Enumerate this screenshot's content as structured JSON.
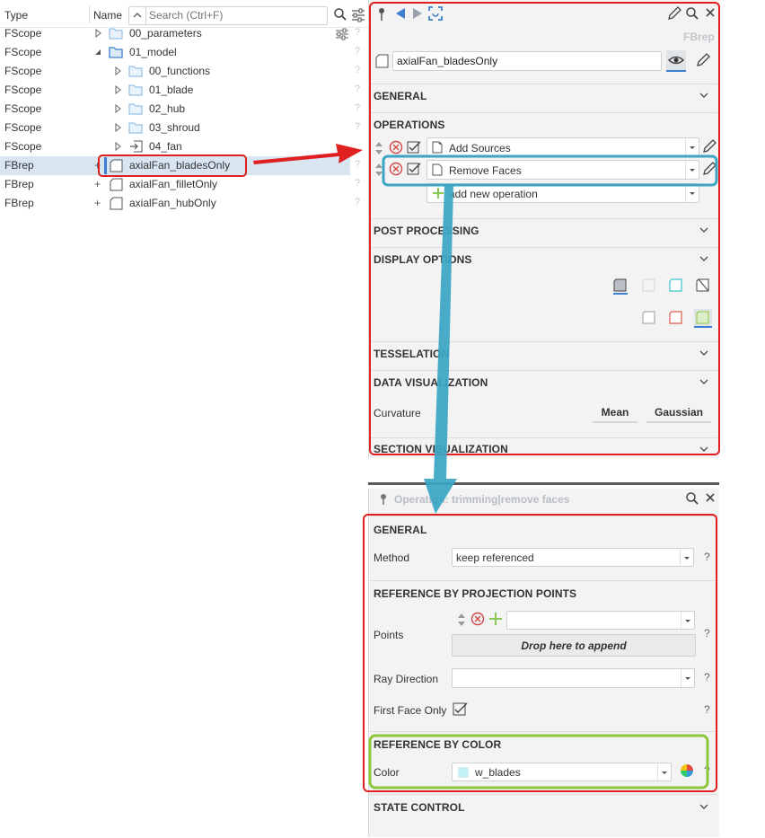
{
  "tree": {
    "col_type": "Type",
    "col_name": "Name",
    "search_placeholder": "Search (Ctrl+F)",
    "rows": [
      {
        "type": "FScope",
        "name": "00_parameters"
      },
      {
        "type": "FScope",
        "name": "01_model"
      },
      {
        "type": "FScope",
        "name": "00_functions"
      },
      {
        "type": "FScope",
        "name": "01_blade"
      },
      {
        "type": "FScope",
        "name": "02_hub"
      },
      {
        "type": "FScope",
        "name": "03_shroud"
      },
      {
        "type": "FScope",
        "name": "04_fan"
      },
      {
        "type": "FBrep",
        "name": "axialFan_bladesOnly"
      },
      {
        "type": "FBrep",
        "name": "axialFan_filletOnly"
      },
      {
        "type": "FBrep",
        "name": "axialFan_hubOnly"
      }
    ],
    "help_mark": "?",
    "expand_plus": "+"
  },
  "object_panel": {
    "type_badge": "FBrep",
    "name_value": "axialFan_bladesOnly",
    "sections": {
      "general": "GENERAL",
      "operations": "OPERATIONS",
      "post_processing": "POST PROCESSING",
      "display_options": "DISPLAY OPTIONS",
      "tesselation": "TESSELATION",
      "data_visualization": "DATA VISUALIZATION",
      "section_visualization": "SECTION VISUALIZATION"
    },
    "operations": [
      {
        "label": "Add Sources"
      },
      {
        "label": "Remove Faces"
      }
    ],
    "add_operation": "add new operation",
    "curvature_label": "Curvature",
    "mean_button": "Mean",
    "gaussian_button": "Gaussian"
  },
  "operation_panel": {
    "title": "Operation: trimming|remove faces",
    "sections": {
      "general": "GENERAL",
      "ref_projection": "REFERENCE BY PROJECTION POINTS",
      "ref_color": "REFERENCE BY COLOR",
      "state_control": "STATE CONTROL"
    },
    "method_label": "Method",
    "method_value": "keep referenced",
    "points_label": "Points",
    "drop_text": "Drop here to append",
    "ray_label": "Ray Direction",
    "first_face_label": "First Face Only",
    "color_label": "Color",
    "color_value": "w_blades",
    "help_mark": "?"
  },
  "colors": {
    "annotation_red": "#e02020",
    "annotation_teal": "#3aa6c4",
    "annotation_green": "#8cc63f",
    "folder_blue": "#5b9bd5",
    "accent_blue": "#3f7fd0"
  }
}
